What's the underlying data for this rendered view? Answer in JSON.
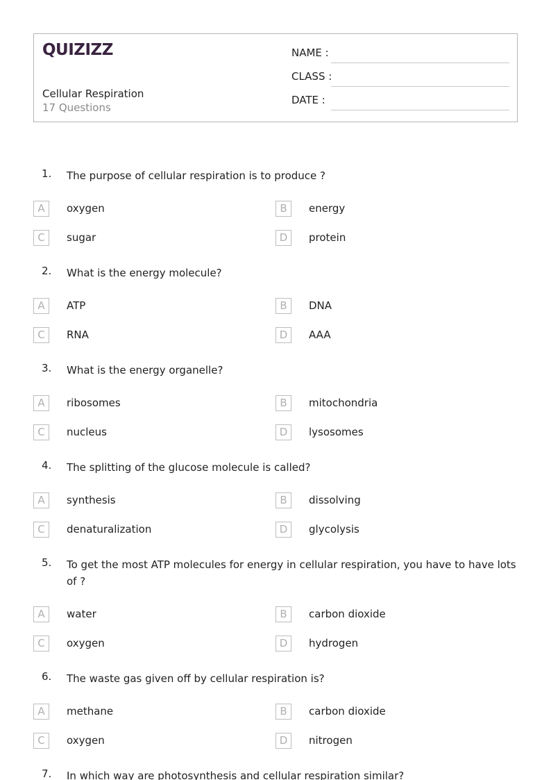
{
  "header": {
    "logo": "QUIZIZZ",
    "title": "Cellular Respiration",
    "question_count": "17 Questions",
    "fields": [
      {
        "label": "NAME :"
      },
      {
        "label": "CLASS :"
      },
      {
        "label": "DATE  :"
      }
    ]
  },
  "questions": [
    {
      "number": "1.",
      "text": "The purpose of cellular respiration is to produce ?",
      "options": [
        {
          "letter": "A",
          "text": "oxygen"
        },
        {
          "letter": "B",
          "text": "energy"
        },
        {
          "letter": "C",
          "text": "sugar"
        },
        {
          "letter": "D",
          "text": "protein"
        }
      ]
    },
    {
      "number": "2.",
      "text": "What is the energy molecule?",
      "options": [
        {
          "letter": "A",
          "text": "ATP"
        },
        {
          "letter": "B",
          "text": "DNA"
        },
        {
          "letter": "C",
          "text": "RNA"
        },
        {
          "letter": "D",
          "text": "AAA"
        }
      ]
    },
    {
      "number": "3.",
      "text": "What is the energy organelle?",
      "options": [
        {
          "letter": "A",
          "text": "ribosomes"
        },
        {
          "letter": "B",
          "text": "mitochondria"
        },
        {
          "letter": "C",
          "text": "nucleus"
        },
        {
          "letter": "D",
          "text": "lysosomes"
        }
      ]
    },
    {
      "number": "4.",
      "text": "The splitting of the glucose molecule is called?",
      "options": [
        {
          "letter": "A",
          "text": "synthesis"
        },
        {
          "letter": "B",
          "text": "dissolving"
        },
        {
          "letter": "C",
          "text": "denaturalization"
        },
        {
          "letter": "D",
          "text": "glycolysis"
        }
      ]
    },
    {
      "number": "5.",
      "text": "To get the most ATP molecules for energy in cellular respiration, you have to have lots of ?",
      "options": [
        {
          "letter": "A",
          "text": "water"
        },
        {
          "letter": "B",
          "text": "carbon dioxide"
        },
        {
          "letter": "C",
          "text": "oxygen"
        },
        {
          "letter": "D",
          "text": "hydrogen"
        }
      ]
    },
    {
      "number": "6.",
      "text": "The waste gas given off by cellular respiration is?",
      "options": [
        {
          "letter": "A",
          "text": "methane"
        },
        {
          "letter": "B",
          "text": "carbon dioxide"
        },
        {
          "letter": "C",
          "text": "oxygen"
        },
        {
          "letter": "D",
          "text": "nitrogen"
        }
      ]
    },
    {
      "number": "7.",
      "text": "In which way are photosynthesis and cellular respiration similar?",
      "options": []
    }
  ]
}
